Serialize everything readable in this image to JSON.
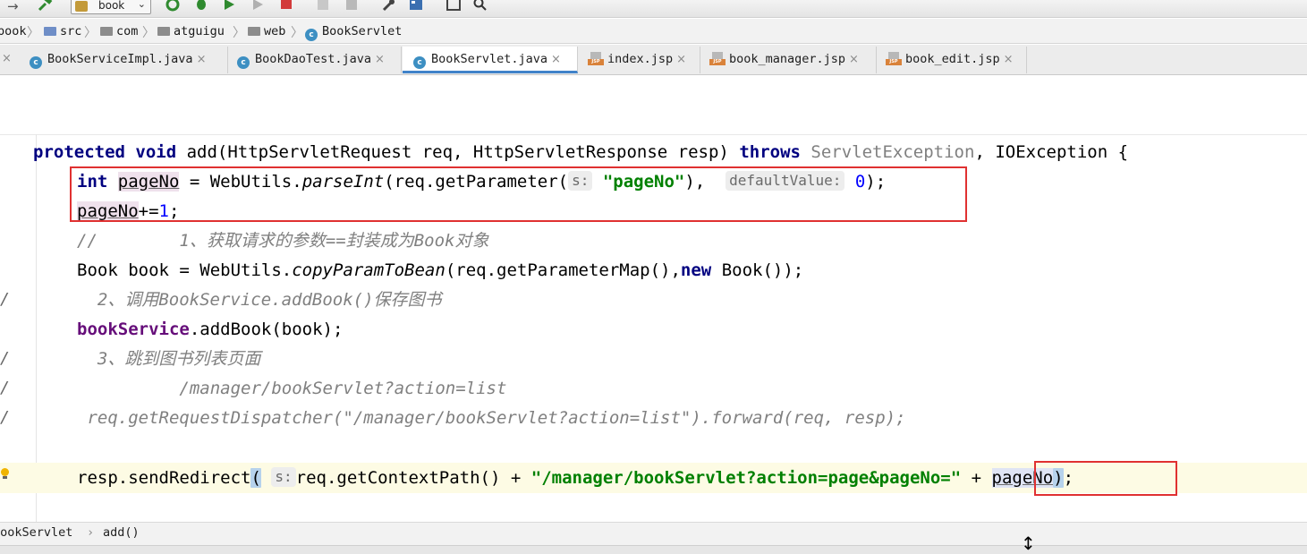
{
  "toolbar": {
    "icons": [
      "back-arrow-icon",
      "build-hammer-icon",
      "run-config-icon",
      "rerun-icon",
      "debug-icon",
      "coverage-icon",
      "profile-icon",
      "stop-icon",
      "vcs-icon",
      "vcs-update-icon",
      "settings-wrench-icon",
      "project-structure-icon",
      "frame-icon",
      "search-icon"
    ],
    "run_config_label": "book"
  },
  "breadcrumb": {
    "items": [
      "book",
      "src",
      "com",
      "atguigu",
      "web",
      "BookServlet"
    ]
  },
  "tabs": [
    {
      "label": "BookServiceImpl.java",
      "type": "class",
      "active": false
    },
    {
      "label": "BookDaoTest.java",
      "type": "class",
      "active": false
    },
    {
      "label": "BookServlet.java",
      "type": "class",
      "active": true
    },
    {
      "label": "index.jsp",
      "type": "jsp",
      "active": false
    },
    {
      "label": "book_manager.jsp",
      "type": "jsp",
      "active": false
    },
    {
      "label": "book_edit.jsp",
      "type": "jsp",
      "active": false
    }
  ],
  "code": {
    "l1": {
      "kw1": "protected",
      "kw2": "void",
      "sig": " add(HttpServletRequest req, HttpServletResponse resp) ",
      "kw3": "throws",
      "ex1": " ServletException",
      "rest": ", IOException {"
    },
    "l2": {
      "kw": "int",
      "var": "pageNo",
      "a": " = WebUtils.",
      "m": "parseInt",
      "b": "(req.getParameter(",
      "hint1": "s:",
      "str": "\"pageNo\"",
      "c": "), ",
      "hint2": "defaultValue:",
      "num": "0",
      "d": ");"
    },
    "l3": {
      "var": "pageNo",
      "a": "+=",
      "num": "1",
      "b": ";"
    },
    "l4": {
      "cmt": "//        1、获取请求的参数==封装成为Book对象"
    },
    "l5": {
      "a": "Book book = WebUtils.",
      "m": "copyParamToBean",
      "b": "(req.getParameterMap(),",
      "kw": "new",
      "c": " Book());"
    },
    "l6": {
      "gm": "/",
      "cmt": "  2、调用BookService.addBook()保存图书"
    },
    "l7": {
      "fld": "bookService",
      "a": ".addBook(book);"
    },
    "l8": {
      "gm": "/",
      "cmt": "  3、跳到图书列表页面"
    },
    "l9": {
      "gm": "/",
      "cmt": "          /manager/bookServlet?action=list"
    },
    "l10": {
      "gm": "/",
      "cmt": " req.getRequestDispatcher(\"/manager/bookServlet?action=list\").forward(req, resp);"
    },
    "l11": {
      "a": "resp.sendRedirect",
      "p": "(",
      "hint": "s:",
      "b": "req.getContextPath() + ",
      "str": "\"/manager/bookServlet?action=page&pageNo=\"",
      "c": " + ",
      "var": "pageNo",
      "p2": ")",
      "d": ";"
    }
  },
  "bottom_breadcrumb": {
    "items": [
      "BookServlet",
      "add()"
    ],
    "separator": "›"
  },
  "colors": {
    "keyword": "#000080",
    "string": "#008000",
    "number": "#0000ff",
    "comment": "#808080",
    "field": "#660e7a",
    "highlight_box": "#e03131",
    "active_tab": "#4083c9"
  }
}
